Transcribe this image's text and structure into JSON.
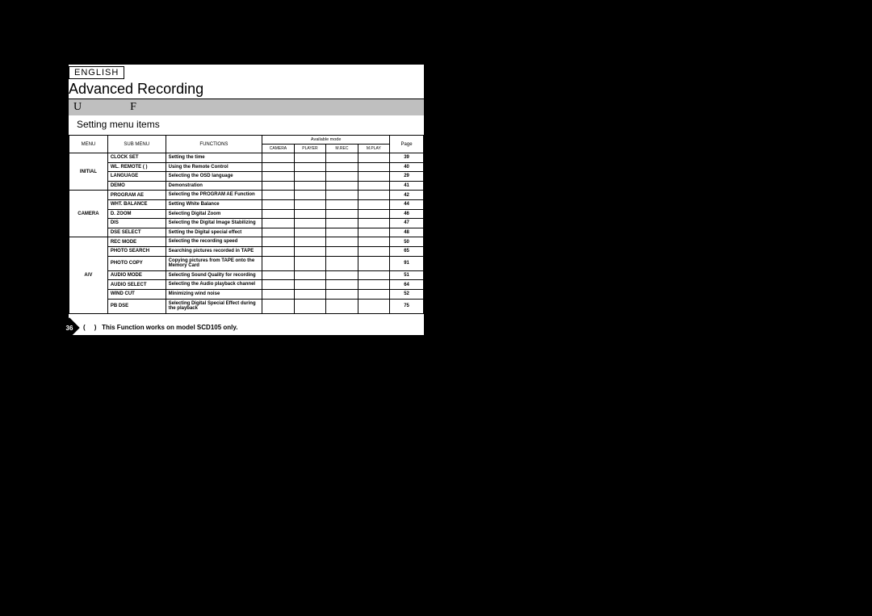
{
  "language_label": "ENGLISH",
  "title": "Advanced Recording",
  "bar_U": "U",
  "bar_F": "F",
  "subheading": "Setting menu items",
  "headers": {
    "menu": "MENU",
    "sub": "SUB MENU",
    "func": "FUNCTIONS",
    "available": "Available mode",
    "camera": "CAMERA",
    "player": "PLAYER",
    "mrec": "M.REC",
    "mplay": "M.PLAY",
    "page": "Page"
  },
  "groups": [
    {
      "menu": "INITIAL",
      "rows": [
        {
          "sub": "CLOCK SET",
          "func": "Setting the time",
          "page": "39"
        },
        {
          "sub": "WL. REMOTE (     )",
          "func": "Using the Remote Control",
          "page": "40"
        },
        {
          "sub": "LANGUAGE",
          "func": "Selecting the OSD language",
          "page": "29"
        },
        {
          "sub": "DEMO",
          "func": "Demonstration",
          "page": "41"
        }
      ]
    },
    {
      "menu": "CAMERA",
      "rows": [
        {
          "sub": "PROGRAM AE",
          "func": "Selecting the PROGRAM AE Function",
          "page": "42"
        },
        {
          "sub": "WHT. BALANCE",
          "func": "Setting White Balance",
          "page": "44"
        },
        {
          "sub": "D. ZOOM",
          "func": "Selecting Digital Zoom",
          "page": "46"
        },
        {
          "sub": "DIS",
          "func": "Selecting the Digital Image Stabilizing",
          "page": "47"
        },
        {
          "sub": "DSE SELECT",
          "func": "Setting the Digital special effect",
          "page": "48"
        }
      ]
    },
    {
      "menu": "A/V",
      "rows": [
        {
          "sub": "REC MODE",
          "func": "Selecting the recording speed",
          "page": "50"
        },
        {
          "sub": "PHOTO SEARCH",
          "func": "Searching pictures recorded in TAPE",
          "page": "65"
        },
        {
          "sub": "PHOTO COPY",
          "func": "Copying pictures from TAPE onto the Memory Card",
          "page": "91"
        },
        {
          "sub": "AUDIO MODE",
          "func": "Selecting Sound Quality for recording",
          "page": "51"
        },
        {
          "sub": "AUDIO SELECT",
          "func": "Selecting the Audio playback channel",
          "page": "64"
        },
        {
          "sub": "WIND CUT",
          "func": "Minimizing wind noise",
          "page": "52"
        },
        {
          "sub": "PB DSE",
          "func": "Selecting Digital Special Effect during the playback",
          "page": "75"
        }
      ]
    }
  ],
  "footnote_paren_open": "(",
  "footnote_paren_close": ")",
  "footnote": "This Function works on model SCD105 only.",
  "page_number": "36"
}
